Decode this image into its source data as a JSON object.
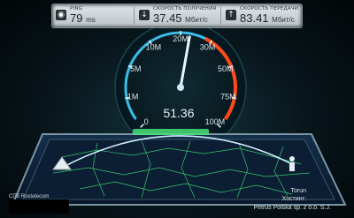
{
  "stats": {
    "ping": {
      "label": "PING",
      "value": "79",
      "unit": "ms",
      "icon": "ping-icon"
    },
    "download": {
      "label": "СКОРОСТЬ ПОЛУЧЕНИЯ",
      "value": "37.45",
      "unit": "Мбит/с",
      "icon": "download-arrow-icon"
    },
    "upload": {
      "label": "СКОРОСТЬ ПЕРЕДАЧИ",
      "value": "83.41",
      "unit": "Мбит/с",
      "icon": "upload-arrow-icon"
    }
  },
  "gauge": {
    "tick_labels": [
      "0",
      "1M",
      "5M",
      "10M",
      "20M",
      "30M",
      "50M",
      "75M",
      "100M"
    ],
    "readout": "51.36",
    "needle_tick_position": 4.3
  },
  "footer": {
    "credit": "СПб Rostelecom",
    "server_city": "Torun",
    "server_host_label": "Хостинг:",
    "server_host": "Petrus Polska sp. z o.o. S.J."
  },
  "colors": {
    "accent_blue": "#3fd0ff",
    "accent_red": "#ff4a1a",
    "accent_green": "#48e07a"
  }
}
